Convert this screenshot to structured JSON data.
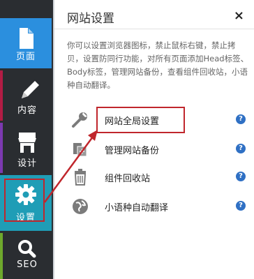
{
  "sidebar": {
    "items": [
      {
        "label": "页面",
        "icon": "page-icon"
      },
      {
        "label": "内容",
        "icon": "pencil-icon"
      },
      {
        "label": "设计",
        "icon": "store-icon"
      },
      {
        "label": "设置",
        "icon": "gear-icon"
      },
      {
        "label": "SEO",
        "icon": "search-icon"
      }
    ]
  },
  "panel": {
    "title": "网站设置",
    "close_label": "×",
    "description": "你可以设置浏览器图标，禁止鼠标右键，禁止拷贝，设置防同行功能，对所有页面添加Head标签、Body标签，管理网站备份，查看组件回收站，小语种自动翻译。",
    "menu": [
      {
        "label": "网站全局设置",
        "icon": "wrench-icon",
        "help": "?"
      },
      {
        "label": "管理网站备份",
        "icon": "backup-icon",
        "help": "?"
      },
      {
        "label": "组件回收站",
        "icon": "trash-icon",
        "help": "?"
      },
      {
        "label": "小语种自动翻译",
        "icon": "globe-icon",
        "help": "?"
      }
    ]
  },
  "colors": {
    "page_tab": "#2b8fde",
    "settings_tab": "#1f9db6",
    "highlight": "#c0262c",
    "help_icon": "#2f70c4"
  }
}
